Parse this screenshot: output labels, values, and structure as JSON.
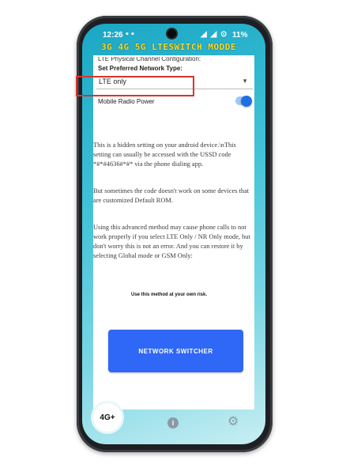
{
  "status_bar": {
    "time": "12:26",
    "left_icons": "▪ ▪",
    "right_icons": "◢ ◢ ⊙",
    "battery": "11%"
  },
  "app": {
    "title": "3G 4G 5G LTESWITCH MODDE"
  },
  "settings": {
    "cut_header": "LTE Physical Channel Configuration:",
    "preferred_label": "Set Preferred Network Type:",
    "dropdown_value": "LTE only",
    "dropdown_arrow": "▼",
    "radio_power_label": "Mobile Radio Power",
    "radio_power_on": true
  },
  "info": {
    "p1": "This is a hidden setting on your android device.\\nThis setting can usually be accessed with the USSD code *#*#4636#*#* via the phone dialing app.",
    "p2": "But sometimes the code doesn't work on some devices that are customized Default ROM.",
    "p3": "Using this advanced method may cause phone calls to not work properly if you select LTE Only / NR Only mode, but don't worry this is not an error. And you can restore it by selecting Global mode or GSM Only:",
    "risk": "Use this method at your own risk."
  },
  "button": {
    "label": "NETWORK SWITCHER"
  },
  "nav": {
    "badge": "4G+",
    "info_glyph": "i",
    "gear_glyph": "⚙"
  },
  "colors": {
    "accent": "#2f67f6",
    "highlight": "#d9342b",
    "title": "#f4e23a",
    "toggle": "#1f6fe0"
  }
}
